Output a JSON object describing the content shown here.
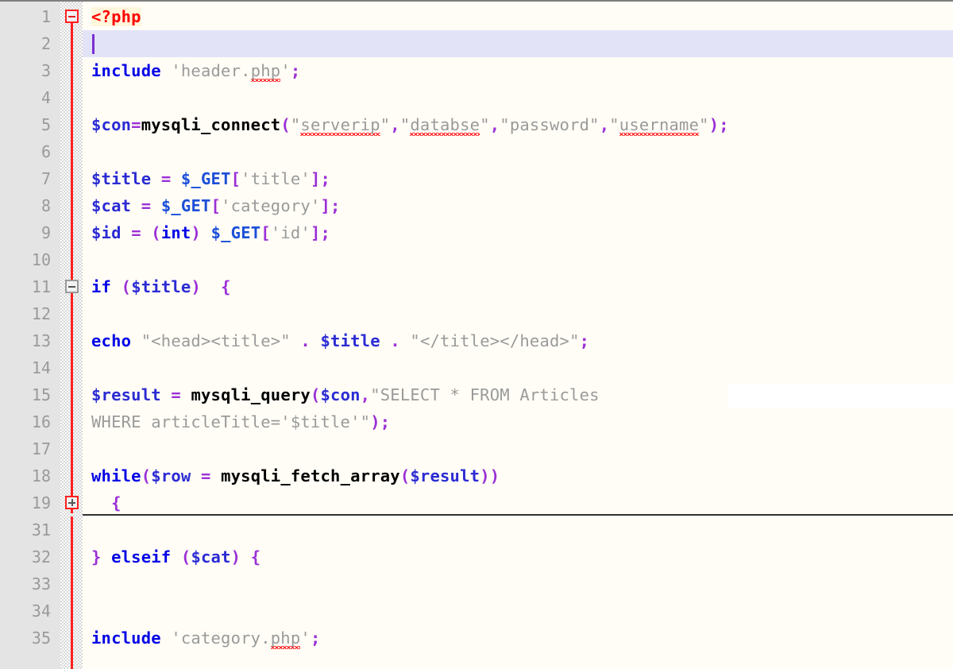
{
  "editor": {
    "app": "code-editor",
    "language": "PHP",
    "background_color": "#FFFDF6",
    "gutter_color": "#E4E4E4",
    "line_number_color": "#9A9A9A",
    "current_line_highlight_color": "#E3E3F8",
    "caret_color": "#7B2FD0",
    "fold_rail_color": "#FF2020",
    "line_height": 34,
    "first_visible_line": 1,
    "caret_line": 2
  },
  "gutter": {
    "line_numbers": [
      "1",
      "2",
      "3",
      "4",
      "5",
      "6",
      "7",
      "8",
      "9",
      "10",
      "11",
      "12",
      "13",
      "14",
      "15",
      "16",
      "17",
      "18",
      "19",
      "31",
      "32",
      "33",
      "34",
      "35"
    ]
  },
  "fold_markers": [
    {
      "line": "1",
      "state": "open",
      "symbol": "−"
    },
    {
      "line": "11",
      "state": "open",
      "symbol": "−"
    },
    {
      "line": "19",
      "state": "closed",
      "symbol": "+"
    }
  ],
  "code_lines": [
    {
      "number": "1",
      "text": "<?php",
      "tokens": [
        {
          "t": "<?php",
          "c": "phptag"
        }
      ]
    },
    {
      "number": "2",
      "text": "",
      "tokens": []
    },
    {
      "number": "3",
      "text": "include 'header.php';",
      "tokens": [
        {
          "t": "include",
          "c": "keyword"
        },
        {
          "t": " ",
          "c": "plain"
        },
        {
          "t": "'header.",
          "c": "string"
        },
        {
          "t": "php",
          "c": "string",
          "squiggly": true
        },
        {
          "t": "'",
          "c": "string"
        },
        {
          "t": ";",
          "c": "punct"
        }
      ]
    },
    {
      "number": "4",
      "text": "",
      "tokens": []
    },
    {
      "number": "5",
      "text": "$con=mysqli_connect(\"serverip\",\"databse\",\"password\",\"username\");",
      "tokens": [
        {
          "t": "$con",
          "c": "var"
        },
        {
          "t": "=",
          "c": "op"
        },
        {
          "t": "mysqli_connect",
          "c": "func"
        },
        {
          "t": "(",
          "c": "punct"
        },
        {
          "t": "\"",
          "c": "string"
        },
        {
          "t": "serverip",
          "c": "string",
          "squiggly": true
        },
        {
          "t": "\"",
          "c": "string"
        },
        {
          "t": ",",
          "c": "punct"
        },
        {
          "t": "\"",
          "c": "string"
        },
        {
          "t": "databse",
          "c": "string",
          "squiggly": true
        },
        {
          "t": "\"",
          "c": "string"
        },
        {
          "t": ",",
          "c": "punct"
        },
        {
          "t": "\"password\"",
          "c": "string"
        },
        {
          "t": ",",
          "c": "punct"
        },
        {
          "t": "\"",
          "c": "string"
        },
        {
          "t": "username",
          "c": "string",
          "squiggly": true
        },
        {
          "t": "\"",
          "c": "string"
        },
        {
          "t": ")",
          "c": "punct"
        },
        {
          "t": ";",
          "c": "punct"
        }
      ]
    },
    {
      "number": "6",
      "text": "",
      "tokens": []
    },
    {
      "number": "7",
      "text": "$title = $_GET['title'];",
      "tokens": [
        {
          "t": "$title",
          "c": "var"
        },
        {
          "t": " ",
          "c": "plain"
        },
        {
          "t": "=",
          "c": "op"
        },
        {
          "t": " ",
          "c": "plain"
        },
        {
          "t": "$_GET",
          "c": "super"
        },
        {
          "t": "[",
          "c": "punct"
        },
        {
          "t": "'title'",
          "c": "string"
        },
        {
          "t": "]",
          "c": "punct"
        },
        {
          "t": ";",
          "c": "punct"
        }
      ]
    },
    {
      "number": "8",
      "text": "$cat = $_GET['category'];",
      "tokens": [
        {
          "t": "$cat",
          "c": "var"
        },
        {
          "t": " ",
          "c": "plain"
        },
        {
          "t": "=",
          "c": "op"
        },
        {
          "t": " ",
          "c": "plain"
        },
        {
          "t": "$_GET",
          "c": "super"
        },
        {
          "t": "[",
          "c": "punct"
        },
        {
          "t": "'category'",
          "c": "string"
        },
        {
          "t": "]",
          "c": "punct"
        },
        {
          "t": ";",
          "c": "punct"
        }
      ]
    },
    {
      "number": "9",
      "text": "$id = (int) $_GET['id'];",
      "tokens": [
        {
          "t": "$id",
          "c": "var"
        },
        {
          "t": " ",
          "c": "plain"
        },
        {
          "t": "=",
          "c": "op"
        },
        {
          "t": " ",
          "c": "plain"
        },
        {
          "t": "(",
          "c": "punct"
        },
        {
          "t": "int",
          "c": "cast"
        },
        {
          "t": ")",
          "c": "punct"
        },
        {
          "t": " ",
          "c": "plain"
        },
        {
          "t": "$_GET",
          "c": "super"
        },
        {
          "t": "[",
          "c": "punct"
        },
        {
          "t": "'id'",
          "c": "string"
        },
        {
          "t": "]",
          "c": "punct"
        },
        {
          "t": ";",
          "c": "punct"
        }
      ]
    },
    {
      "number": "10",
      "text": "",
      "tokens": []
    },
    {
      "number": "11",
      "text": "if ($title)  {",
      "tokens": [
        {
          "t": "if",
          "c": "keyword"
        },
        {
          "t": " ",
          "c": "plain"
        },
        {
          "t": "(",
          "c": "punct"
        },
        {
          "t": "$title",
          "c": "var"
        },
        {
          "t": ")",
          "c": "punct"
        },
        {
          "t": "  ",
          "c": "plain"
        },
        {
          "t": "{",
          "c": "punct"
        }
      ]
    },
    {
      "number": "12",
      "text": "",
      "tokens": []
    },
    {
      "number": "13",
      "text": "echo \"<head><title>\" . $title . \"</title></head>\";",
      "tokens": [
        {
          "t": "echo",
          "c": "keyword"
        },
        {
          "t": " ",
          "c": "plain"
        },
        {
          "t": "\"<head><title>\"",
          "c": "string"
        },
        {
          "t": " ",
          "c": "plain"
        },
        {
          "t": ".",
          "c": "op"
        },
        {
          "t": " ",
          "c": "plain"
        },
        {
          "t": "$title",
          "c": "var"
        },
        {
          "t": " ",
          "c": "plain"
        },
        {
          "t": ".",
          "c": "op"
        },
        {
          "t": " ",
          "c": "plain"
        },
        {
          "t": "\"</title></head>\"",
          "c": "string"
        },
        {
          "t": ";",
          "c": "punct"
        }
      ]
    },
    {
      "number": "14",
      "text": "",
      "tokens": []
    },
    {
      "number": "15",
      "text": "$result = mysqli_query($con,\"SELECT * FROM Articles ",
      "tokens": [
        {
          "t": "$result",
          "c": "var"
        },
        {
          "t": " ",
          "c": "plain"
        },
        {
          "t": "=",
          "c": "op"
        },
        {
          "t": " ",
          "c": "plain"
        },
        {
          "t": "mysqli_query",
          "c": "func"
        },
        {
          "t": "(",
          "c": "punct"
        },
        {
          "t": "$con",
          "c": "var"
        },
        {
          "t": ",",
          "c": "punct"
        },
        {
          "t": "\"SELECT * FROM Articles ",
          "c": "string"
        }
      ]
    },
    {
      "number": "16",
      "text": "WHERE articleTitle='$title'\");",
      "tokens": [
        {
          "t": "WHERE articleTitle='",
          "c": "string"
        },
        {
          "t": "$title",
          "c": "string"
        },
        {
          "t": "'\"",
          "c": "string"
        },
        {
          "t": ")",
          "c": "punct"
        },
        {
          "t": ";",
          "c": "punct"
        }
      ]
    },
    {
      "number": "17",
      "text": "",
      "tokens": []
    },
    {
      "number": "18",
      "text": "while($row = mysqli_fetch_array($result))",
      "tokens": [
        {
          "t": "while",
          "c": "keyword"
        },
        {
          "t": "(",
          "c": "punct"
        },
        {
          "t": "$row",
          "c": "var"
        },
        {
          "t": " ",
          "c": "plain"
        },
        {
          "t": "=",
          "c": "op"
        },
        {
          "t": " ",
          "c": "plain"
        },
        {
          "t": "mysqli_fetch_array",
          "c": "func"
        },
        {
          "t": "(",
          "c": "punct"
        },
        {
          "t": "$result",
          "c": "var"
        },
        {
          "t": ")",
          "c": "punct"
        },
        {
          "t": ")",
          "c": "punct"
        }
      ]
    },
    {
      "number": "19",
      "text": "  {",
      "tokens": [
        {
          "t": "  ",
          "c": "plain"
        },
        {
          "t": "{",
          "c": "punct"
        }
      ]
    },
    {
      "number": "31",
      "text": "",
      "tokens": []
    },
    {
      "number": "32",
      "text": "} elseif ($cat) {",
      "tokens": [
        {
          "t": "}",
          "c": "punct"
        },
        {
          "t": " ",
          "c": "plain"
        },
        {
          "t": "elseif",
          "c": "keyword"
        },
        {
          "t": " ",
          "c": "plain"
        },
        {
          "t": "(",
          "c": "punct"
        },
        {
          "t": "$cat",
          "c": "var"
        },
        {
          "t": ")",
          "c": "punct"
        },
        {
          "t": " ",
          "c": "plain"
        },
        {
          "t": "{",
          "c": "punct"
        }
      ]
    },
    {
      "number": "33",
      "text": "",
      "tokens": []
    },
    {
      "number": "34",
      "text": "",
      "tokens": []
    },
    {
      "number": "35",
      "text": "include 'category.php';",
      "tokens": [
        {
          "t": "include",
          "c": "keyword"
        },
        {
          "t": " ",
          "c": "plain"
        },
        {
          "t": "'category.",
          "c": "string"
        },
        {
          "t": "php",
          "c": "string",
          "squiggly": true
        },
        {
          "t": "'",
          "c": "string"
        },
        {
          "t": ";",
          "c": "punct"
        }
      ]
    }
  ]
}
